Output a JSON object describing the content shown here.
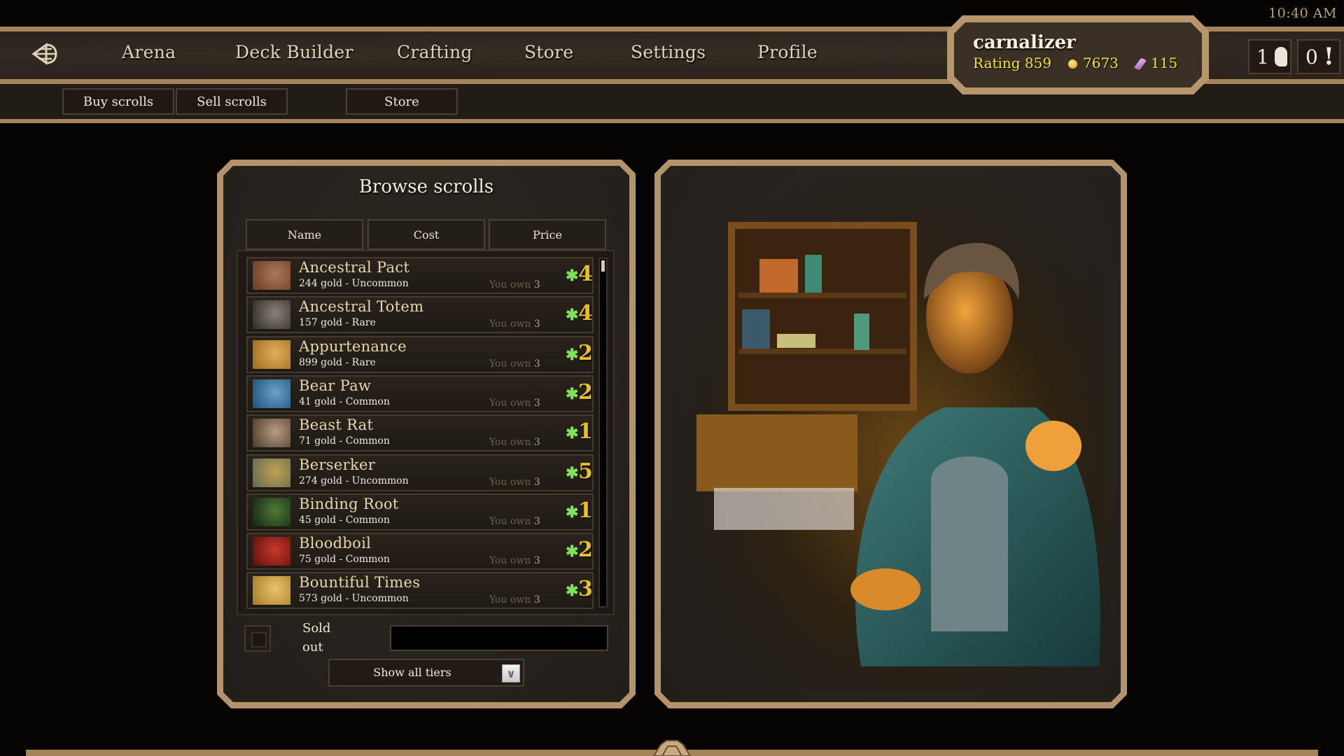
{
  "clock": "10:40 AM",
  "nav": {
    "back_icon": "back-arrow-icon",
    "items": [
      {
        "label": "Arena"
      },
      {
        "label": "Deck Builder"
      },
      {
        "label": "Crafting"
      },
      {
        "label": "Store"
      },
      {
        "label": "Settings"
      },
      {
        "label": "Profile"
      }
    ]
  },
  "subnav": {
    "buy_scrolls": "Buy scrolls",
    "sell_scrolls": "Sell scrolls",
    "store": "Store"
  },
  "profile": {
    "username": "carnalizer",
    "rating_label": "Rating 859",
    "gold": "7673",
    "shards": "115",
    "gold_icon": "gold-coin-icon",
    "shard_icon": "shard-icon"
  },
  "notifications": {
    "friends_count": "1",
    "alerts_count": "0"
  },
  "browse": {
    "title": "Browse scrolls",
    "columns": [
      "Name",
      "Cost",
      "Price"
    ],
    "own_label": "You own",
    "rows": [
      {
        "name": "Ancestral Pact",
        "detail": "244 gold - Uncommon",
        "owned": "3",
        "price": "4",
        "thumb_colors": [
          "#6b3a22",
          "#a87a5a"
        ]
      },
      {
        "name": "Ancestral Totem",
        "detail": "157 gold - Rare",
        "owned": "3",
        "price": "4",
        "thumb_colors": [
          "#2e2a28",
          "#8a8076"
        ]
      },
      {
        "name": "Appurtenance",
        "detail": "899 gold - Rare",
        "owned": "3",
        "price": "2",
        "thumb_colors": [
          "#9a6a22",
          "#e2b057"
        ]
      },
      {
        "name": "Bear Paw",
        "detail": "41 gold - Common",
        "owned": "3",
        "price": "2",
        "thumb_colors": [
          "#1f4f7a",
          "#6aa0c8"
        ]
      },
      {
        "name": "Beast Rat",
        "detail": "71 gold - Common",
        "owned": "3",
        "price": "1",
        "thumb_colors": [
          "#4a3a26",
          "#b89c86"
        ]
      },
      {
        "name": "Berserker",
        "detail": "274 gold - Uncommon",
        "owned": "3",
        "price": "5",
        "thumb_colors": [
          "#5d6a52",
          "#c2a050"
        ]
      },
      {
        "name": "Binding Root",
        "detail": "45 gold - Common",
        "owned": "3",
        "price": "1",
        "thumb_colors": [
          "#13240f",
          "#4f7a3a"
        ]
      },
      {
        "name": "Bloodboil",
        "detail": "75 gold - Common",
        "owned": "3",
        "price": "2",
        "thumb_colors": [
          "#5a0f0c",
          "#c8382c"
        ]
      },
      {
        "name": "Bountiful Times",
        "detail": "573 gold - Uncommon",
        "owned": "3",
        "price": "3",
        "thumb_colors": [
          "#a47a2a",
          "#e8c46a"
        ]
      }
    ],
    "price_icon": "shard-star-icon",
    "sold_out_label": "Sold out",
    "search_value": "",
    "tier_select": "Show all tiers"
  },
  "colors": {
    "frame_gold": "#b4936a",
    "price_yellow": "#e6c02a",
    "price_icon_green": "#7fe25a",
    "rating_yellow": "#f4e33a"
  }
}
